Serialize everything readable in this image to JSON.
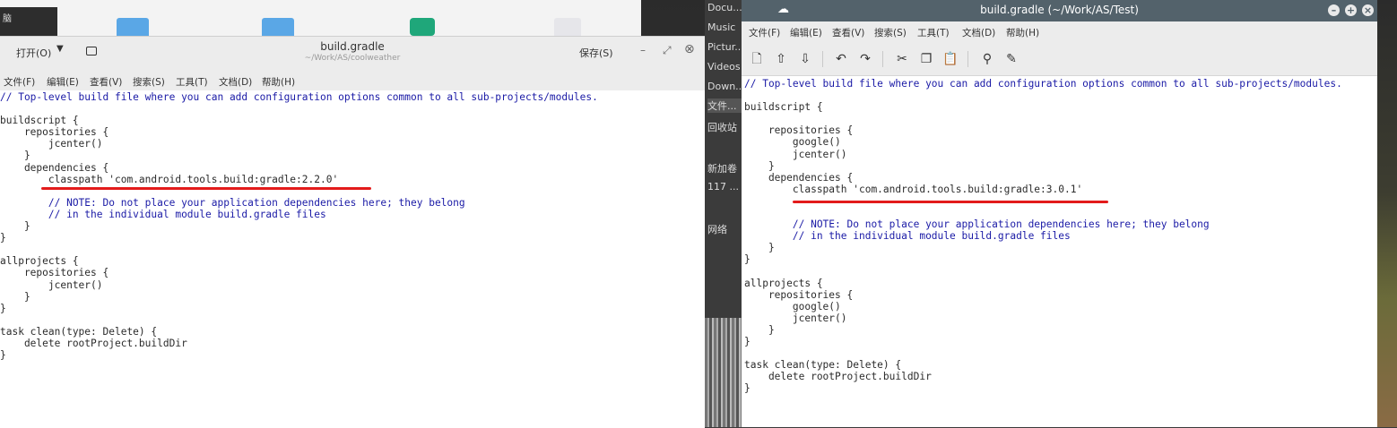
{
  "background": {
    "left_strip_label": "脑",
    "file_manager_sidebar": [
      "Docu...",
      "Music",
      "Pictur...",
      "Videos",
      "Down...",
      "文件...",
      "回收站",
      "新加卷",
      "117 ...",
      "网络"
    ]
  },
  "left_window": {
    "open_button": "打开(O)",
    "title": "build.gradle",
    "path": "~/Work/AS/coolweather",
    "save_button": "保存(S)",
    "window_buttons": [
      "–",
      "⤢",
      "⊗"
    ],
    "menu": [
      "文件(F)",
      "编辑(E)",
      "查看(V)",
      "搜索(S)",
      "工具(T)",
      "文档(D)",
      "帮助(H)"
    ],
    "code": {
      "l1": "// Top-level build file where you can add configuration options common to all sub-projects/modules.",
      "l2": "",
      "l3": "buildscript {",
      "l4": "    repositories {",
      "l5": "        jcenter()",
      "l6": "    }",
      "l7": "    dependencies {",
      "l8": "        classpath 'com.android.tools.build:gradle:2.2.0'",
      "l9": "",
      "l10": "        // NOTE: Do not place your application dependencies here; they belong",
      "l11": "        // in the individual module build.gradle files",
      "l12": "    }",
      "l13": "}",
      "l14": "",
      "l15": "allprojects {",
      "l16": "    repositories {",
      "l17": "        jcenter()",
      "l18": "    }",
      "l19": "}",
      "l20": "",
      "l21": "task clean(type: Delete) {",
      "l22": "    delete rootProject.buildDir",
      "l23": "}"
    }
  },
  "right_window": {
    "title": "build.gradle (~/Work/AS/Test)",
    "window_buttons": [
      "–",
      "+",
      "×"
    ],
    "menu": [
      "文件(F)",
      "编辑(E)",
      "查看(V)",
      "搜索(S)",
      "工具(T)",
      "文档(D)",
      "帮助(H)"
    ],
    "toolbar_icons": [
      "new-file-icon",
      "upload-icon",
      "download-icon",
      "undo-icon",
      "redo-icon",
      "cut-icon",
      "copy-icon",
      "paste-icon",
      "search-icon",
      "search-replace-icon"
    ],
    "code": {
      "l1": "// Top-level build file where you can add configuration options common to all sub-projects/modules.",
      "l2": "",
      "l3": "buildscript {",
      "l4": "",
      "l5": "    repositories {",
      "l6": "        google()",
      "l7": "        jcenter()",
      "l8": "    }",
      "l9": "    dependencies {",
      "l10": "        classpath 'com.android.tools.build:gradle:3.0.1'",
      "l11": "",
      "l12": "",
      "l13": "        // NOTE: Do not place your application dependencies here; they belong",
      "l14": "        // in the individual module build.gradle files",
      "l15": "    }",
      "l16": "}",
      "l17": "",
      "l18": "allprojects {",
      "l19": "    repositories {",
      "l20": "        google()",
      "l21": "        jcenter()",
      "l22": "    }",
      "l23": "}",
      "l24": "",
      "l25": "task clean(type: Delete) {",
      "l26": "    delete rootProject.buildDir",
      "l27": "}"
    }
  },
  "colors": {
    "comment": "#1a1aa6",
    "underline": "#e31b1b",
    "titlebar": "#53626b"
  }
}
